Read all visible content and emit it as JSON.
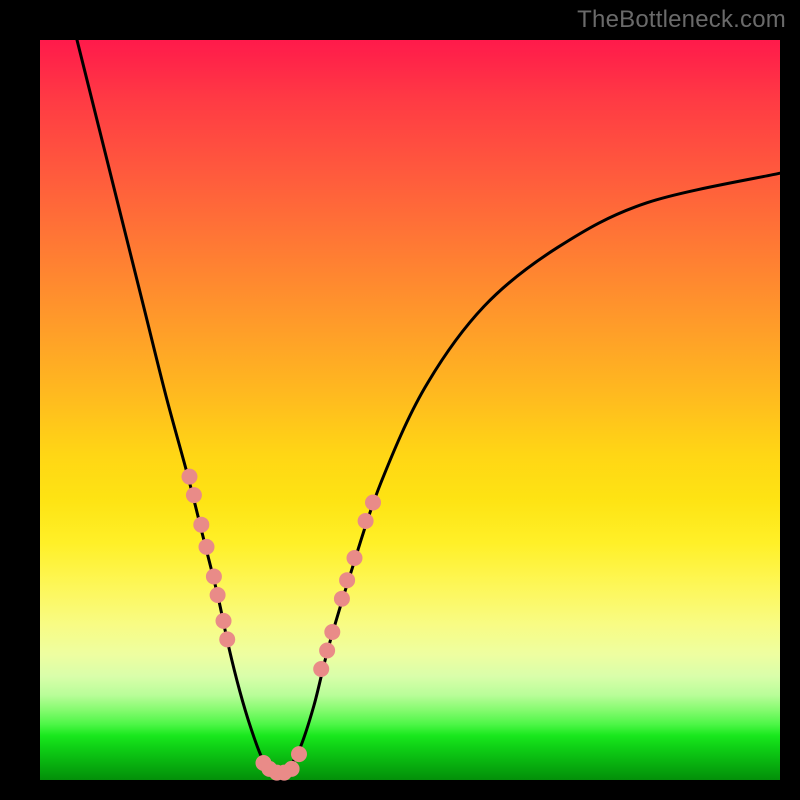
{
  "watermark": "TheBottleneck.com",
  "chart_data": {
    "type": "line",
    "title": "",
    "xlabel": "",
    "ylabel": "",
    "xlim": [
      0,
      100
    ],
    "ylim": [
      0,
      100
    ],
    "grid": false,
    "legend": false,
    "series": [
      {
        "name": "bottleneck-curve",
        "x": [
          5,
          8,
          11,
          14,
          17,
          20,
          22,
          24,
          25.5,
          27,
          28.5,
          30,
          31.5,
          33,
          35,
          37,
          39,
          42,
          46,
          52,
          60,
          70,
          82,
          100
        ],
        "y": [
          100,
          88,
          76,
          64,
          52,
          41,
          33,
          25,
          18,
          12,
          7,
          3,
          1,
          1,
          4,
          10,
          18,
          28,
          40,
          53,
          64,
          72,
          78,
          82
        ],
        "color": "#000000",
        "stroke_width": 2
      }
    ],
    "markers": [
      {
        "series": "left-dots",
        "color": "#e98b88",
        "radius": 8,
        "points_xy": [
          [
            20.2,
            41
          ],
          [
            20.8,
            38.5
          ],
          [
            21.8,
            34.5
          ],
          [
            22.5,
            31.5
          ],
          [
            23.5,
            27.5
          ],
          [
            24,
            25
          ],
          [
            24.8,
            21.5
          ],
          [
            25.3,
            19
          ]
        ]
      },
      {
        "series": "bottom-dots",
        "color": "#e98b88",
        "radius": 8,
        "points_xy": [
          [
            30.2,
            2.3
          ],
          [
            31,
            1.5
          ],
          [
            32,
            1
          ],
          [
            33,
            1
          ],
          [
            34,
            1.5
          ],
          [
            35,
            3.5
          ]
        ]
      },
      {
        "series": "right-dots",
        "color": "#e98b88",
        "radius": 8,
        "points_xy": [
          [
            38,
            15
          ],
          [
            38.8,
            17.5
          ],
          [
            39.5,
            20
          ],
          [
            40.8,
            24.5
          ],
          [
            41.5,
            27
          ],
          [
            42.5,
            30
          ],
          [
            44,
            35
          ],
          [
            45,
            37.5
          ]
        ]
      }
    ]
  }
}
